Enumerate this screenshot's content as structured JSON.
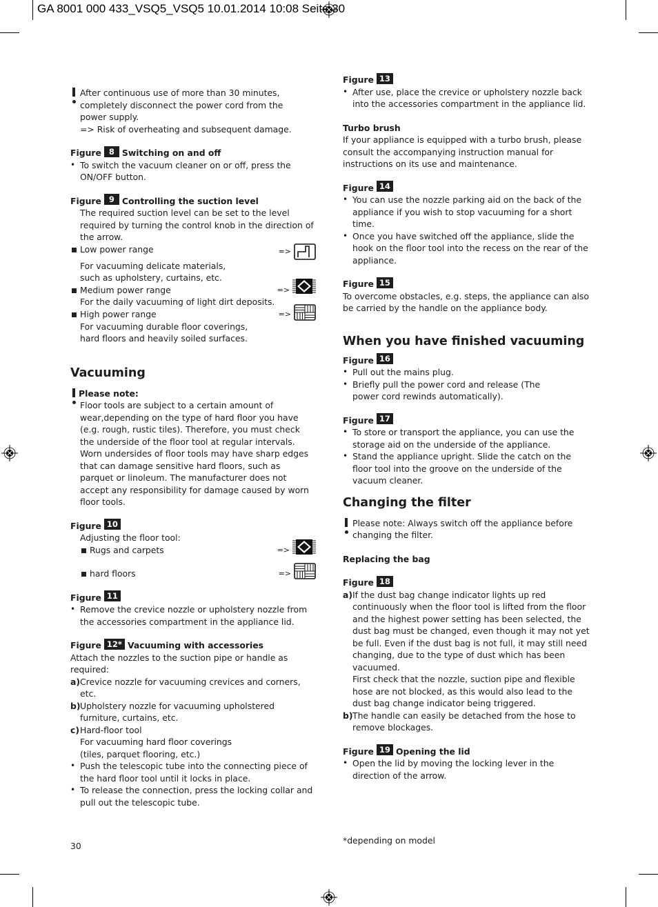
{
  "header": {
    "print_info": "GA 8001 000 433_VSQ5_VSQ5  10.01.2014  10:08  Seite 30"
  },
  "left": {
    "warning1": [
      "After continuous use of more than 30 minutes,",
      "completely disconnect the power cord from the",
      "power supply.",
      "=> Risk of overheating and subsequent damage."
    ],
    "fig8": {
      "label": "Figure",
      "num": "8",
      "title": "Switching on and off",
      "bullets": [
        "To switch the vacuum cleaner on or off, press the ON/OFF button."
      ]
    },
    "fig9": {
      "label": "Figure",
      "num": "9",
      "title": "Controlling the suction level",
      "intro": "The required suction level can be set to the level required by turning the control knob in the direction of the arrow.",
      "levels": [
        {
          "name": "Low power range",
          "arrow": "=>",
          "icon": "low-power-icon",
          "desc": [
            "For vacuuming delicate materials,",
            "such as upholstery, curtains, etc."
          ]
        },
        {
          "name": "Medium power range",
          "arrow": "=>",
          "icon": "carpet-icon",
          "desc": [
            "For the daily vacuuming of light dirt deposits."
          ]
        },
        {
          "name": "High power range",
          "arrow": "=>",
          "icon": "hard-floor-icon",
          "desc": [
            "For vacuuming durable floor coverings,",
            "hard floors and heavily soiled surfaces."
          ]
        }
      ]
    },
    "vacuuming": {
      "heading": "Vacuuming",
      "note_title": "Please note:",
      "note_text": "Floor tools are subject to a certain amount of wear,depending on the type of hard floor you have (e.g. rough, rustic tiles). Therefore, you must check the underside of the floor tool at regular intervals. Worn undersides of floor tools may have sharp edges that can damage sensitive hard floors, such as parquet or linoleum. The manufacturer does not accept any responsibility for damage caused by worn floor tools."
    },
    "fig10": {
      "label": "Figure",
      "num": "10",
      "intro": "Adjusting the floor tool:",
      "items": [
        {
          "name": "Rugs and carpets",
          "arrow": "=>",
          "icon": "carpet-icon"
        },
        {
          "name": "hard floors",
          "arrow": "=>",
          "icon": "hard-floor-icon"
        }
      ]
    },
    "fig11": {
      "label": "Figure",
      "num": "11",
      "bullets": [
        "Remove the crevice nozzle or upholstery nozzle from the accessories compartment in the appliance lid."
      ]
    },
    "fig12": {
      "label": "Figure",
      "num": "12*",
      "title": "Vacuuming with accessories",
      "intro": "Attach the nozzles to the suction pipe or handle as required:",
      "items": [
        {
          "key": "a)",
          "text": "Crevice nozzle for vacuuming crevices and corners, etc."
        },
        {
          "key": "b)",
          "text": "Upholstery nozzle for vacuuming upholstered furniture, curtains, etc."
        },
        {
          "key": "c)",
          "text": "Hard-floor tool",
          "extra": [
            "For vacuuming hard floor coverings",
            "(tiles, parquet flooring, etc.)"
          ]
        }
      ],
      "bullets": [
        "Push the telescopic tube into the connecting piece of the hard floor tool until it locks in place.",
        "To release the connection, press the locking collar and pull out the telescopic tube."
      ]
    },
    "page_number": "30"
  },
  "right": {
    "fig13": {
      "label": "Figure",
      "num": "13",
      "bullets": [
        "After use, place the crevice or upholstery nozzle back into the accessories compartment in the appliance lid."
      ]
    },
    "turbo": {
      "title": "Turbo brush",
      "text": "If your appliance is equipped with a turbo brush, please consult the accompanying instruction manual for instructions on its use and maintenance."
    },
    "fig14": {
      "label": "Figure",
      "num": "14",
      "bullets": [
        "You can use the nozzle parking aid on the back of the appliance if you wish to stop vacuuming for a short time.",
        "Once you have switched off the appliance, slide the hook on the floor tool into the recess on the rear of the appliance."
      ]
    },
    "fig15": {
      "label": "Figure",
      "num": "15",
      "text": "To overcome obstacles, e.g. steps, the appliance can also be carried by the handle on the appliance body."
    },
    "finished": {
      "heading": "When you have finished vacuuming"
    },
    "fig16": {
      "label": "Figure",
      "num": "16",
      "bullets": [
        "Pull out the mains plug.",
        "Briefly pull the power cord and release (The power cord rewinds automatically)."
      ]
    },
    "fig17": {
      "label": "Figure",
      "num": "17",
      "bullets": [
        "To store or transport the appliance, you can use the storage aid on the underside of the appliance.",
        "Stand the appliance upright. Slide the catch on the floor tool into the groove on the underside of the vacuum cleaner."
      ]
    },
    "filter": {
      "heading": "Changing the filter",
      "note": "Please note: Always switch off the appliance before changing the filter.",
      "subheading": "Replacing the bag"
    },
    "fig18": {
      "label": "Figure",
      "num": "18",
      "items": [
        {
          "key": "a)",
          "text": "If the dust bag change indicator lights up red continuously when the floor tool is lifted from the floor and the highest power setting has been selected, the dust bag must be changed, even though it may not yet be full. Even if the dust bag is not full, it may still need changing, due to the type of dust which has been vacuumed.",
          "extra": "First check that the nozzle, suction pipe and flexible hose are not blocked, as this would also lead to the dust bag change indicator being triggered."
        },
        {
          "key": "b)",
          "text": "The handle can easily be detached from the hose to remove blockages."
        }
      ]
    },
    "fig19": {
      "label": "Figure",
      "num": "19",
      "title": "Opening the lid",
      "bullets": [
        "Open the lid by moving the locking lever in the direction of the arrow."
      ]
    },
    "footnote": "*depending on model"
  }
}
